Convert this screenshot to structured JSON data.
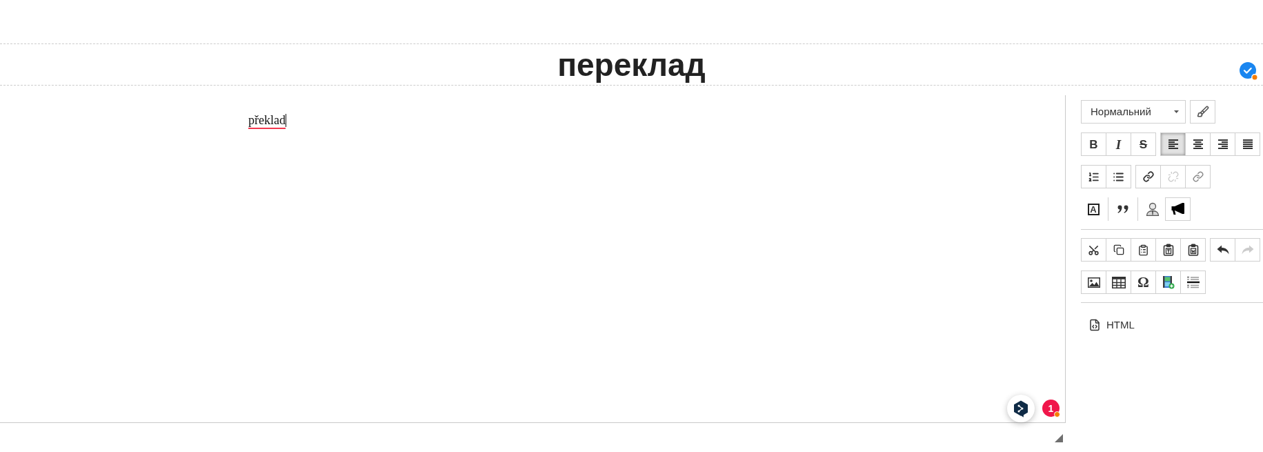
{
  "title_bar": {
    "title": "переклад"
  },
  "editor": {
    "text": "překlad",
    "misspelled": true
  },
  "notification_badge": {
    "count": "1"
  },
  "toolbar": {
    "sections": [
      {
        "rows": [
          {
            "groups": [
              {
                "kind": "select",
                "value": "Нормальний"
              },
              {
                "kind": "bordered",
                "buttons": [
                  {
                    "kind": "brush",
                    "pressed": false,
                    "disabled": false
                  }
                ]
              }
            ]
          },
          {
            "groups": [
              {
                "kind": "bordered",
                "buttons": [
                  {
                    "kind": "bold",
                    "glyph": "B",
                    "pressed": false,
                    "disabled": false
                  },
                  {
                    "kind": "italic",
                    "glyph": "I",
                    "pressed": false,
                    "disabled": false
                  },
                  {
                    "kind": "strike",
                    "glyph": "S",
                    "pressed": false,
                    "disabled": false
                  }
                ]
              },
              {
                "kind": "bordered",
                "buttons": [
                  {
                    "kind": "align-left",
                    "pressed": true,
                    "disabled": false
                  },
                  {
                    "kind": "align-center",
                    "pressed": false,
                    "disabled": false
                  },
                  {
                    "kind": "align-right",
                    "pressed": false,
                    "disabled": false
                  },
                  {
                    "kind": "align-justify",
                    "pressed": false,
                    "disabled": false
                  }
                ]
              }
            ]
          },
          {
            "groups": [
              {
                "kind": "bordered",
                "buttons": [
                  {
                    "kind": "numbered-list",
                    "pressed": false,
                    "disabled": false
                  },
                  {
                    "kind": "bulleted-list",
                    "pressed": false,
                    "disabled": false
                  }
                ]
              },
              {
                "kind": "bordered",
                "buttons": [
                  {
                    "kind": "link",
                    "pressed": false,
                    "disabled": false
                  },
                  {
                    "kind": "unlink",
                    "pressed": false,
                    "disabled": true
                  },
                  {
                    "kind": "anchor",
                    "pressed": false,
                    "disabled": false
                  }
                ]
              }
            ]
          },
          {
            "groups": [
              {
                "kind": "plain",
                "buttons": [
                  {
                    "kind": "boxed-letter",
                    "glyph": "A",
                    "pressed": false,
                    "disabled": false
                  }
                ]
              },
              {
                "kind": "plain",
                "buttons": [
                  {
                    "kind": "quote",
                    "pressed": false,
                    "disabled": false
                  }
                ]
              },
              {
                "kind": "plain",
                "buttons": [
                  {
                    "kind": "person",
                    "pressed": false,
                    "disabled": false
                  }
                ]
              },
              {
                "kind": "bordered",
                "buttons": [
                  {
                    "kind": "megaphone",
                    "pressed": false,
                    "disabled": false
                  }
                ]
              }
            ]
          }
        ]
      },
      {
        "rows": [
          {
            "groups": [
              {
                "kind": "bordered",
                "buttons": [
                  {
                    "kind": "cut",
                    "pressed": false,
                    "disabled": false
                  },
                  {
                    "kind": "copy",
                    "pressed": false,
                    "disabled": false
                  },
                  {
                    "kind": "paste",
                    "pressed": false,
                    "disabled": false
                  },
                  {
                    "kind": "paste-text",
                    "pressed": false,
                    "disabled": false
                  },
                  {
                    "kind": "paste-word",
                    "pressed": false,
                    "disabled": false
                  }
                ]
              },
              {
                "kind": "bordered",
                "buttons": [
                  {
                    "kind": "undo",
                    "pressed": false,
                    "disabled": false
                  },
                  {
                    "kind": "redo",
                    "pressed": false,
                    "disabled": true
                  }
                ]
              }
            ]
          },
          {
            "groups": [
              {
                "kind": "bordered",
                "buttons": [
                  {
                    "kind": "image",
                    "pressed": false,
                    "disabled": false
                  },
                  {
                    "kind": "table",
                    "pressed": false,
                    "disabled": false
                  },
                  {
                    "kind": "omega",
                    "glyph": "Ω",
                    "pressed": false,
                    "disabled": false
                  },
                  {
                    "kind": "video",
                    "pressed": false,
                    "disabled": false
                  },
                  {
                    "kind": "page-break",
                    "pressed": false,
                    "disabled": false
                  }
                ]
              }
            ]
          }
        ]
      }
    ]
  },
  "source_link": {
    "label": "HTML"
  }
}
